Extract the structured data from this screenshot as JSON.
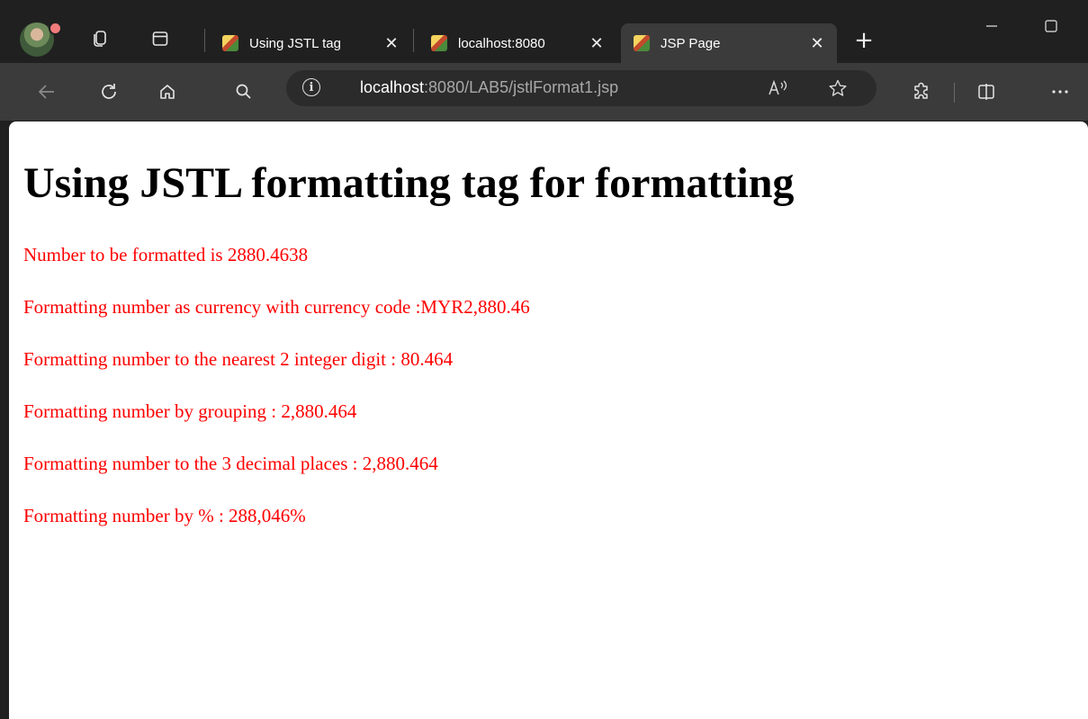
{
  "browser": {
    "tabs": [
      {
        "title": "Using JSTL tag",
        "active": false
      },
      {
        "title": "localhost:8080",
        "active": false
      },
      {
        "title": "JSP Page",
        "active": true
      }
    ],
    "address": {
      "host": "localhost",
      "rest": ":8080/LAB5/jstlFormat1.jsp"
    },
    "icons": {
      "profile": "profile-avatar",
      "workspaces": "workspaces-icon",
      "tab_actions": "tab-actions-icon",
      "tab_close": "close-icon",
      "new_tab": "plus-icon",
      "back": "back-arrow-icon",
      "refresh": "refresh-icon",
      "home": "home-icon",
      "search": "search-icon",
      "site_info": "info-icon",
      "read_aloud": "read-aloud-icon",
      "favorite": "star-icon",
      "extensions": "extensions-icon",
      "split_screen": "split-screen-icon",
      "more": "more-icon"
    },
    "colors": {
      "chrome_dark": "#202020",
      "toolbar": "#3b3b3b",
      "omnibox": "#2b2b2b"
    }
  },
  "page": {
    "heading": "Using JSTL formatting tag for formatting",
    "lines": [
      "Number to be formatted is 2880.4638",
      "Formatting number as currency with currency code :MYR2,880.46",
      "Formatting number to the nearest 2 integer digit : 80.464",
      "Formatting number by grouping : 2,880.464",
      "Formatting number to the 3 decimal places : 2,880.464",
      "Formatting number by % : 288,046%"
    ],
    "colors": {
      "heading": "#000000",
      "text": "#ff0000"
    }
  }
}
